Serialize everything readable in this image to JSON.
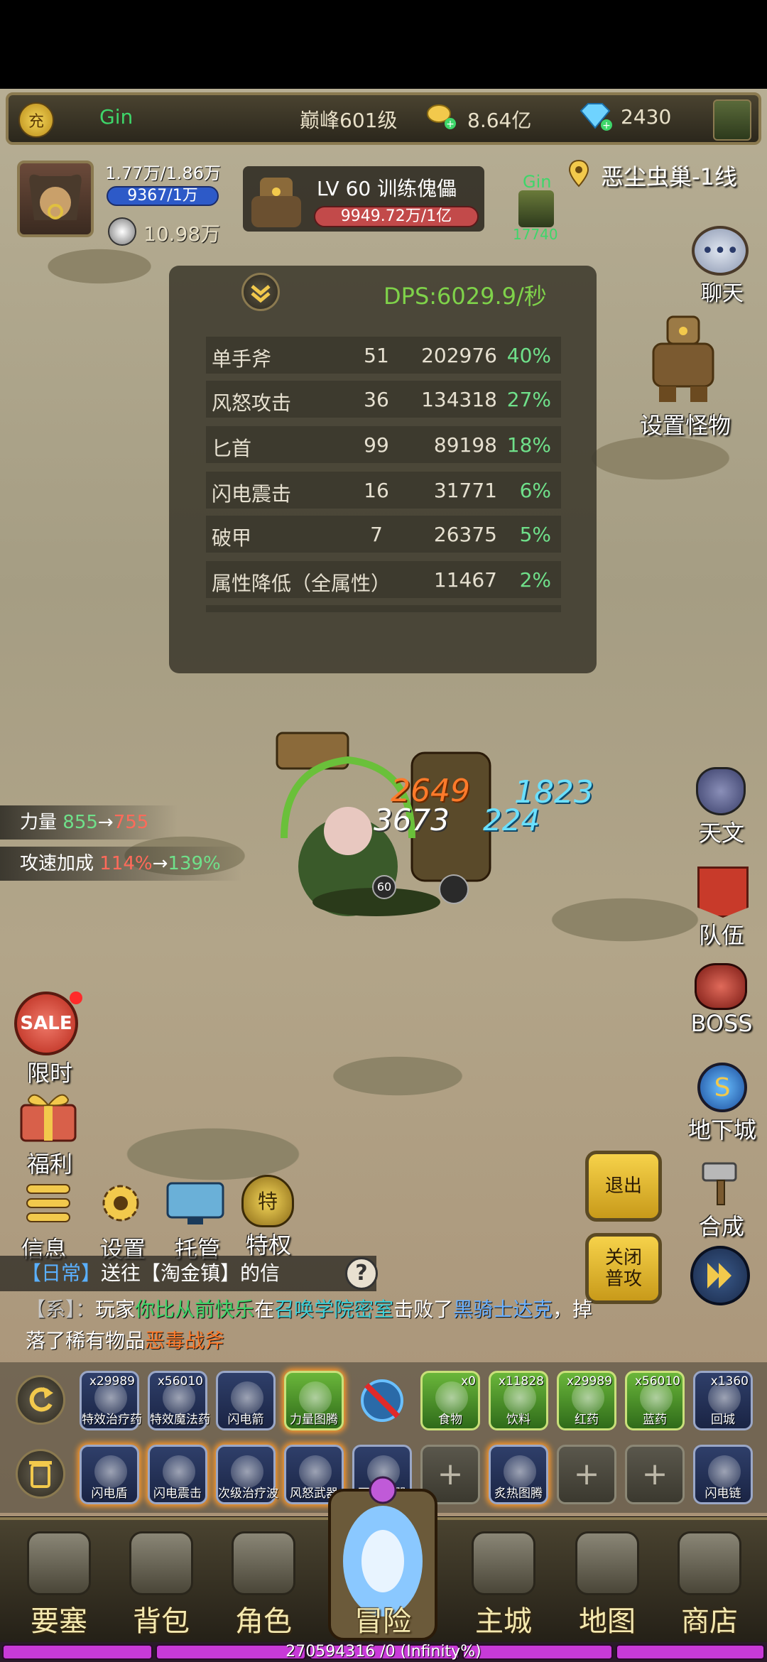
{
  "topbar": {
    "recharge_icon_label": "充",
    "player_name": "Gin",
    "rank": "巅峰601级",
    "gold": "8.64亿",
    "diamonds": "2430"
  },
  "player": {
    "hp": "1.77万/1.86万",
    "mp": "9367/1万",
    "power": "10.98万"
  },
  "target": {
    "title": "LV 60 训练傀儡",
    "hp": "9949.72万/1亿",
    "ally_name": "Gin",
    "ally_value": "17740"
  },
  "location": "恶尘虫巢-1线",
  "dps": {
    "header": "DPS:6029.9/秒",
    "rows": [
      {
        "skill": "单手斧",
        "hits": "51",
        "damage": "202976",
        "pct": "40%"
      },
      {
        "skill": "风怒攻击",
        "hits": "36",
        "damage": "134318",
        "pct": "27%"
      },
      {
        "skill": "匕首",
        "hits": "99",
        "damage": "89198",
        "pct": "18%"
      },
      {
        "skill": "闪电震击",
        "hits": "16",
        "damage": "31771",
        "pct": "6%"
      },
      {
        "skill": "破甲",
        "hits": "7",
        "damage": "26375",
        "pct": "5%"
      },
      {
        "skill": "属性降低（全属性）",
        "hits": "",
        "damage": "11467",
        "pct": "2%"
      }
    ]
  },
  "right_menu": {
    "chat": "聊天",
    "set_monster": "设置怪物",
    "tianwen": "天文",
    "team": "队伍",
    "boss": "BOSS",
    "dungeon": "地下城",
    "craft": "合成"
  },
  "buffs": {
    "strength_label": "力量",
    "strength_from": "855",
    "strength_to": "755",
    "atkspd_label": "攻速加成",
    "atkspd_from": "114%",
    "atkspd_to": "139%",
    "arrow": "→"
  },
  "battle": {
    "dmg1": "2649",
    "dmg2": "1823",
    "dmg3": "3673",
    "dmg4": "224",
    "level_badge": "60"
  },
  "left_menu": {
    "limited": "限时",
    "sale_text": "SALE",
    "welfare": "福利",
    "info": "信息",
    "settings": "设置",
    "auto": "托管",
    "privilege": "特权"
  },
  "action_buttons": {
    "exit": "退出",
    "close_attack": "关闭\n普攻"
  },
  "chat_log": {
    "quest_tag": "【日常】",
    "quest_text": "送往【淘金镇】的信",
    "sys_tag": "【系】：",
    "sys_text_1": "玩家",
    "sys_player": "你比从前快乐",
    "sys_text_2": "在",
    "sys_place": "召唤学院密室",
    "sys_text_3": "击败了",
    "sys_boss": "黑骑士达克",
    "sys_text_4": "，掉",
    "sys_text_5": "落了稀有物品",
    "sys_item": "恶毒战斧"
  },
  "skillbar_row1": [
    {
      "label": "特效治疗药",
      "count": "x29989",
      "style": "blue"
    },
    {
      "label": "特效魔法药",
      "count": "x56010",
      "style": "blue"
    },
    {
      "label": "闪电箭",
      "count": "",
      "style": "blue"
    },
    {
      "label": "力量图腾",
      "count": "",
      "style": "green-glow"
    },
    {
      "label": "",
      "count": "",
      "style": "none"
    },
    {
      "label": "食物",
      "count": "x0",
      "style": "green"
    },
    {
      "label": "饮料",
      "count": "x11828",
      "style": "green"
    },
    {
      "label": "红药",
      "count": "x29989",
      "style": "green"
    },
    {
      "label": "蓝药",
      "count": "x56010",
      "style": "green"
    },
    {
      "label": "回城",
      "count": "x1360",
      "style": "blue"
    }
  ],
  "skillbar_row2": [
    {
      "label": "闪电盾",
      "style": "blue-glow"
    },
    {
      "label": "闪电震击",
      "style": "blue-glow"
    },
    {
      "label": "次级治疗波",
      "style": "blue-glow"
    },
    {
      "label": "风怒武器",
      "style": "blue-glow"
    },
    {
      "label": "石化武器",
      "style": "blue"
    },
    {
      "label": "+",
      "style": "gray"
    },
    {
      "label": "炙热图腾",
      "style": "blue-glow"
    },
    {
      "label": "+",
      "style": "gray"
    },
    {
      "label": "+",
      "style": "gray"
    },
    {
      "label": "闪电链",
      "style": "blue"
    }
  ],
  "bottom_nav": [
    "要塞",
    "背包",
    "角色",
    "冒险",
    "主城",
    "地图",
    "商店"
  ],
  "exp_bar": "270594316 /0 (Infinity%)",
  "colors": {
    "accent_gold": "#f2c94c",
    "dps_green": "#7fd24a",
    "pct_green": "#6fe08a"
  }
}
